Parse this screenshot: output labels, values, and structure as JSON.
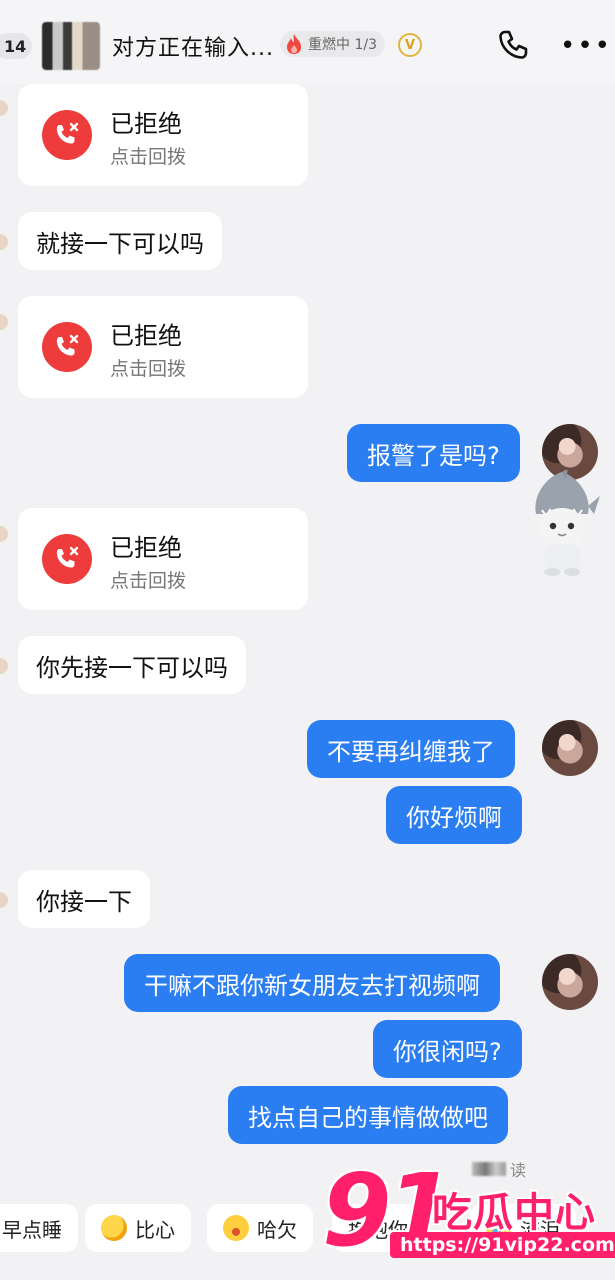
{
  "header": {
    "back_count": "14",
    "title": "对方正在输入...",
    "burn_badge": "重燃中 1/3",
    "vip_label": "V"
  },
  "messages": {
    "call_1": {
      "title": "已拒绝",
      "subtitle": "点击回拨"
    },
    "in_1": "就接一下可以吗",
    "call_2": {
      "title": "已拒绝",
      "subtitle": "点击回拨"
    },
    "out_1": "报警了是吗?",
    "call_3": {
      "title": "已拒绝",
      "subtitle": "点击回拨"
    },
    "in_2": "你先接一下可以吗",
    "out_2": "不要再纠缠我了",
    "out_3": "你好烦啊",
    "in_3": "你接一下",
    "out_4": "干嘛不跟你新女朋友去打视频啊",
    "out_5": "你很闲吗?",
    "out_6": "找点自己的事情做做吧",
    "read_receipt": "读"
  },
  "quick_replies": [
    {
      "label": "早点睡",
      "icon": "none"
    },
    {
      "label": "比心",
      "icon": "heart-hands-emoji"
    },
    {
      "label": "哈欠",
      "icon": "yawn-emoji"
    },
    {
      "label": "抱抱你",
      "icon": "none"
    },
    {
      "label": "流泪",
      "icon": "tear-emoji"
    }
  ],
  "watermark": {
    "number": "91",
    "brand": "吃瓜中心",
    "url": "https://91vip22.com"
  },
  "colors": {
    "outgoing_bubble": "#2a7ef2",
    "incoming_bubble": "#ffffff",
    "background": "#f2f2f4",
    "call_icon": "#ee3b3b",
    "watermark": "#ff1f6a"
  }
}
